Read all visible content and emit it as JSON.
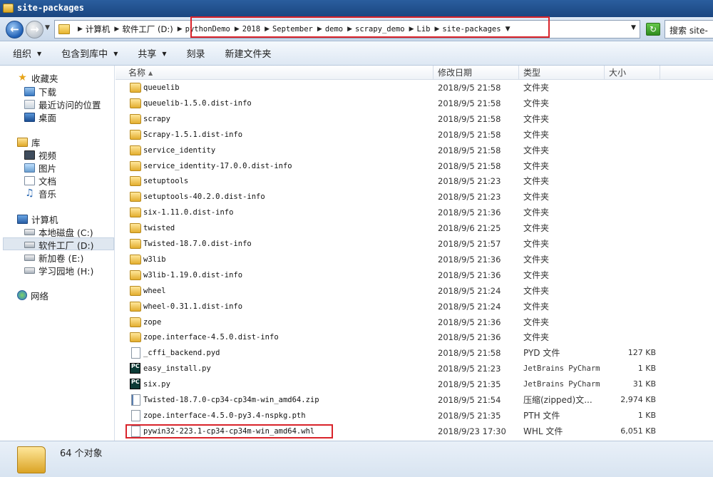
{
  "window": {
    "title": "site-packages"
  },
  "address": {
    "crumbs": [
      {
        "label": "计算机",
        "mono": false
      },
      {
        "label": "软件工厂 (D:)",
        "mono": false
      },
      {
        "label": "pythonDemo",
        "mono": true
      },
      {
        "label": "2018",
        "mono": true
      },
      {
        "label": "September",
        "mono": true
      },
      {
        "label": "demo",
        "mono": true
      },
      {
        "label": "scrapy_demo",
        "mono": true
      },
      {
        "label": "Lib",
        "mono": true
      },
      {
        "label": "site-packages",
        "mono": true
      }
    ],
    "search_text": "搜索 site-"
  },
  "toolbar": {
    "organize": "组织",
    "include_library": "包含到库中",
    "share": "共享",
    "burn": "刻录",
    "new_folder": "新建文件夹"
  },
  "sidebar": {
    "favorites": "收藏夹",
    "downloads": "下载",
    "recent": "最近访问的位置",
    "desktop": "桌面",
    "libraries": "库",
    "videos": "视频",
    "pictures": "图片",
    "documents": "文档",
    "music": "音乐",
    "computer": "计算机",
    "drive_c": "本地磁盘 (C:)",
    "drive_d": "软件工厂 (D:)",
    "drive_e": "新加卷 (E:)",
    "drive_h": "学习园地 (H:)",
    "network": "网络"
  },
  "columns": {
    "name": "名称",
    "date": "修改日期",
    "type": "类型",
    "size": "大小"
  },
  "files": [
    {
      "name": "queuelib",
      "date": "2018/9/5 21:58",
      "type": "文件夹",
      "size": "",
      "icon": "folder"
    },
    {
      "name": "queuelib-1.5.0.dist-info",
      "date": "2018/9/5 21:58",
      "type": "文件夹",
      "size": "",
      "icon": "folder"
    },
    {
      "name": "scrapy",
      "date": "2018/9/5 21:58",
      "type": "文件夹",
      "size": "",
      "icon": "folder"
    },
    {
      "name": "Scrapy-1.5.1.dist-info",
      "date": "2018/9/5 21:58",
      "type": "文件夹",
      "size": "",
      "icon": "folder"
    },
    {
      "name": "service_identity",
      "date": "2018/9/5 21:58",
      "type": "文件夹",
      "size": "",
      "icon": "folder"
    },
    {
      "name": "service_identity-17.0.0.dist-info",
      "date": "2018/9/5 21:58",
      "type": "文件夹",
      "size": "",
      "icon": "folder"
    },
    {
      "name": "setuptools",
      "date": "2018/9/5 21:23",
      "type": "文件夹",
      "size": "",
      "icon": "folder"
    },
    {
      "name": "setuptools-40.2.0.dist-info",
      "date": "2018/9/5 21:23",
      "type": "文件夹",
      "size": "",
      "icon": "folder"
    },
    {
      "name": "six-1.11.0.dist-info",
      "date": "2018/9/5 21:36",
      "type": "文件夹",
      "size": "",
      "icon": "folder"
    },
    {
      "name": "twisted",
      "date": "2018/9/6 21:25",
      "type": "文件夹",
      "size": "",
      "icon": "folder"
    },
    {
      "name": "Twisted-18.7.0.dist-info",
      "date": "2018/9/5 21:57",
      "type": "文件夹",
      "size": "",
      "icon": "folder"
    },
    {
      "name": "w3lib",
      "date": "2018/9/5 21:36",
      "type": "文件夹",
      "size": "",
      "icon": "folder"
    },
    {
      "name": "w3lib-1.19.0.dist-info",
      "date": "2018/9/5 21:36",
      "type": "文件夹",
      "size": "",
      "icon": "folder"
    },
    {
      "name": "wheel",
      "date": "2018/9/5 21:24",
      "type": "文件夹",
      "size": "",
      "icon": "folder"
    },
    {
      "name": "wheel-0.31.1.dist-info",
      "date": "2018/9/5 21:24",
      "type": "文件夹",
      "size": "",
      "icon": "folder"
    },
    {
      "name": "zope",
      "date": "2018/9/5 21:36",
      "type": "文件夹",
      "size": "",
      "icon": "folder"
    },
    {
      "name": "zope.interface-4.5.0.dist-info",
      "date": "2018/9/5 21:36",
      "type": "文件夹",
      "size": "",
      "icon": "folder"
    },
    {
      "name": "_cffi_backend.pyd",
      "date": "2018/9/5 21:58",
      "type": "PYD 文件",
      "size": "127 KB",
      "icon": "file"
    },
    {
      "name": "easy_install.py",
      "date": "2018/9/5 21:23",
      "type": "JetBrains PyCharm",
      "size": "1 KB",
      "icon": "pycharm"
    },
    {
      "name": "six.py",
      "date": "2018/9/5 21:35",
      "type": "JetBrains PyCharm",
      "size": "31 KB",
      "icon": "pycharm"
    },
    {
      "name": "Twisted-18.7.0-cp34-cp34m-win_amd64.zip",
      "date": "2018/9/5 21:54",
      "type": "压缩(zipped)文...",
      "size": "2,974 KB",
      "icon": "zip"
    },
    {
      "name": "zope.interface-4.5.0-py3.4-nspkg.pth",
      "date": "2018/9/5 21:35",
      "type": "PTH 文件",
      "size": "1 KB",
      "icon": "file"
    },
    {
      "name": "pywin32-223.1-cp34-cp34m-win_amd64.whl",
      "date": "2018/9/23 17:30",
      "type": "WHL 文件",
      "size": "6,051 KB",
      "icon": "file"
    }
  ],
  "status": {
    "count_text": "64 个对象"
  },
  "colors": {
    "highlight_box": "#d9232a",
    "titlebar": "#1a4680"
  }
}
